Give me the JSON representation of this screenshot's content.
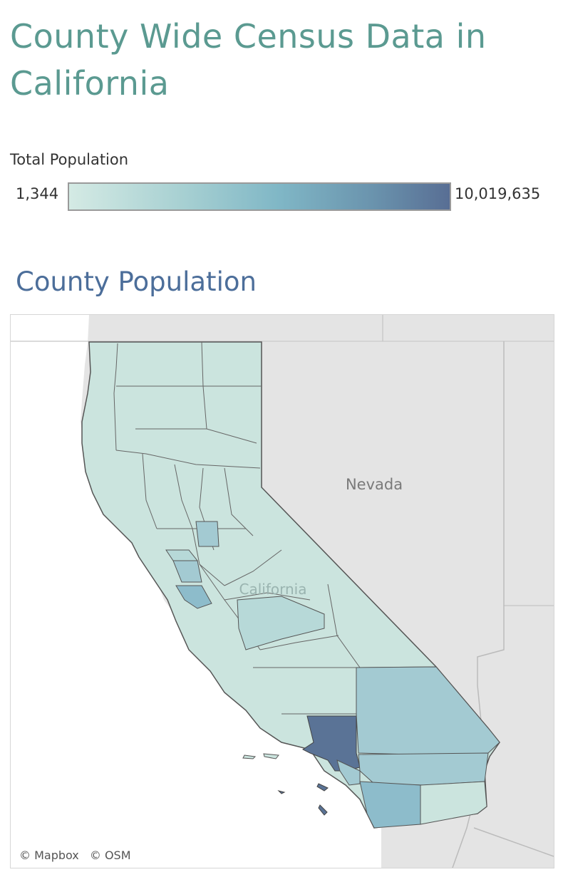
{
  "page": {
    "title": "County Wide Census Data in California"
  },
  "legend": {
    "title": "Total Population",
    "min_label": "1,344",
    "max_label": "10,019,635",
    "colors": [
      "#d4eae4",
      "#a7d0d2",
      "#80b7c6",
      "#6a93ad",
      "#586e94"
    ]
  },
  "map": {
    "title": "County Population",
    "labels": {
      "neighbor_state": "Nevada",
      "main_state": "California"
    },
    "attribution": [
      "© Mapbox",
      "© OSM"
    ],
    "fills": {
      "land": "#e4e4e4",
      "water": "#ffffff",
      "county_default": "#cbe4de",
      "county_light": "#b7d9d8",
      "county_mid": "#a3cad2",
      "county_mid2": "#8dbccb",
      "county_dark": "#5a7396",
      "outline": "#555555"
    }
  }
}
